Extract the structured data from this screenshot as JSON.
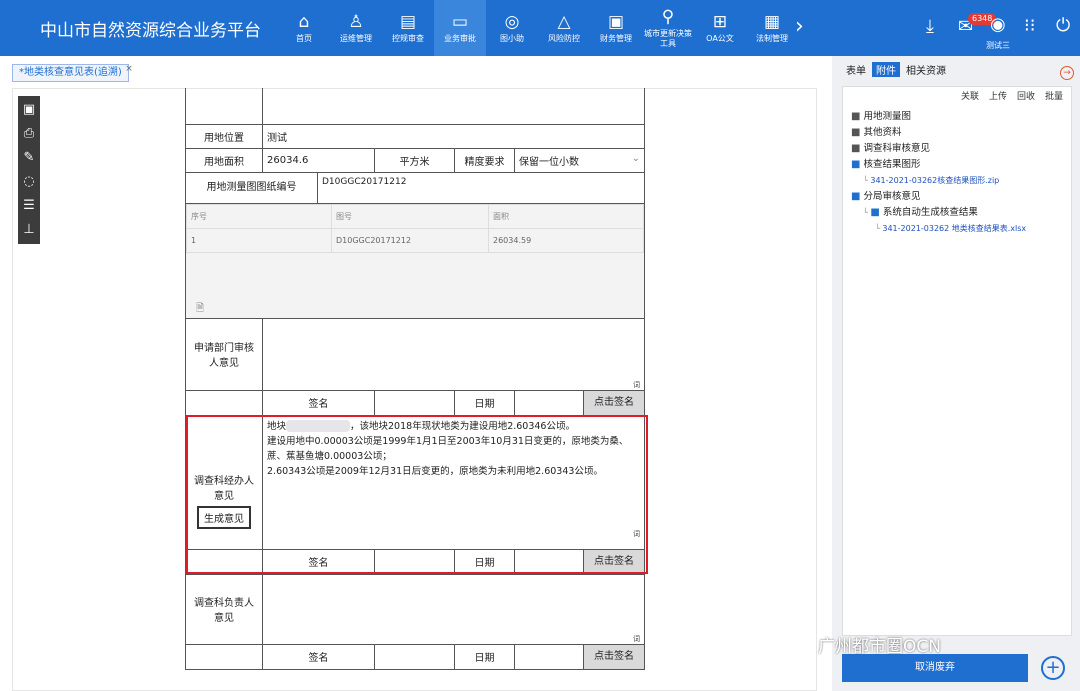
{
  "app": {
    "title": "中山市自然资源综合业务平台"
  },
  "nav": [
    {
      "label": "首页",
      "icon": "⌂"
    },
    {
      "label": "运维管理",
      "icon": "♙"
    },
    {
      "label": "控规审查",
      "icon": "▤"
    },
    {
      "label": "业务审批",
      "icon": "▭"
    },
    {
      "label": "图小助",
      "icon": "◎"
    },
    {
      "label": "风险防控",
      "icon": "△"
    },
    {
      "label": "财务管理",
      "icon": "▣"
    },
    {
      "label": "城市更新决策工具",
      "icon": "⚲"
    },
    {
      "label": "OA公文",
      "icon": "⊞"
    },
    {
      "label": "法制管理",
      "icon": "▦"
    }
  ],
  "user": {
    "name": "测试三",
    "msg_count": "6348"
  },
  "tab": {
    "label": "*地类核查意见表(追溯)",
    "close": "×"
  },
  "form": {
    "location_label": "用地位置",
    "location_value": "测试",
    "area_label": "用地面积",
    "area_value": "26034.6",
    "area_unit": "平方米",
    "precision_label": "精度要求",
    "precision_value": "保留一位小数",
    "drawing_label": "用地测量图图纸编号",
    "drawing_value": "D10GGC20171212",
    "sub_headers": [
      "序号",
      "图号",
      "面积"
    ],
    "sub_row": [
      "1",
      "D10GGC20171212",
      "26034.59"
    ],
    "dept_opinion_label": "申请部门审核人意见",
    "sign_label": "签名",
    "date_label": "日期",
    "sign_btn": "点击签名",
    "char": "词",
    "handler_label": "调查科经办人意见",
    "gen_btn": "生成意见",
    "opinion_pre": "地块",
    "opinion_l1": "，该地块2018年现状地类为建设用地2.60346公顷。",
    "opinion_l2": "建设用地中0.00003公顷是1999年1月1日至2003年10月31日变更的，原地类为桑、",
    "opinion_l3": "蔗、蕉基鱼塘0.00003公顷；",
    "opinion_l4": "2.60343公顷是2009年12月31日后变更的，原地类为未利用地2.60343公顷。",
    "chief_label": "调查科负责人意见"
  },
  "side": {
    "tabs": [
      "表单",
      "附件",
      "相关资源"
    ],
    "actions": [
      "关联",
      "上传",
      "回收",
      "批量"
    ],
    "tree": [
      "用地测量图",
      "其他资料",
      "调查科审核意见",
      "核查结果图形",
      "341-2021-03262核查结果图形.zip",
      "分局审核意见",
      "系统自动生成核查结果",
      "341-2021-03262 地类核查结果表.xlsx"
    ],
    "cancel": "取消废弃"
  },
  "watermark": "广州都市圈OCN"
}
